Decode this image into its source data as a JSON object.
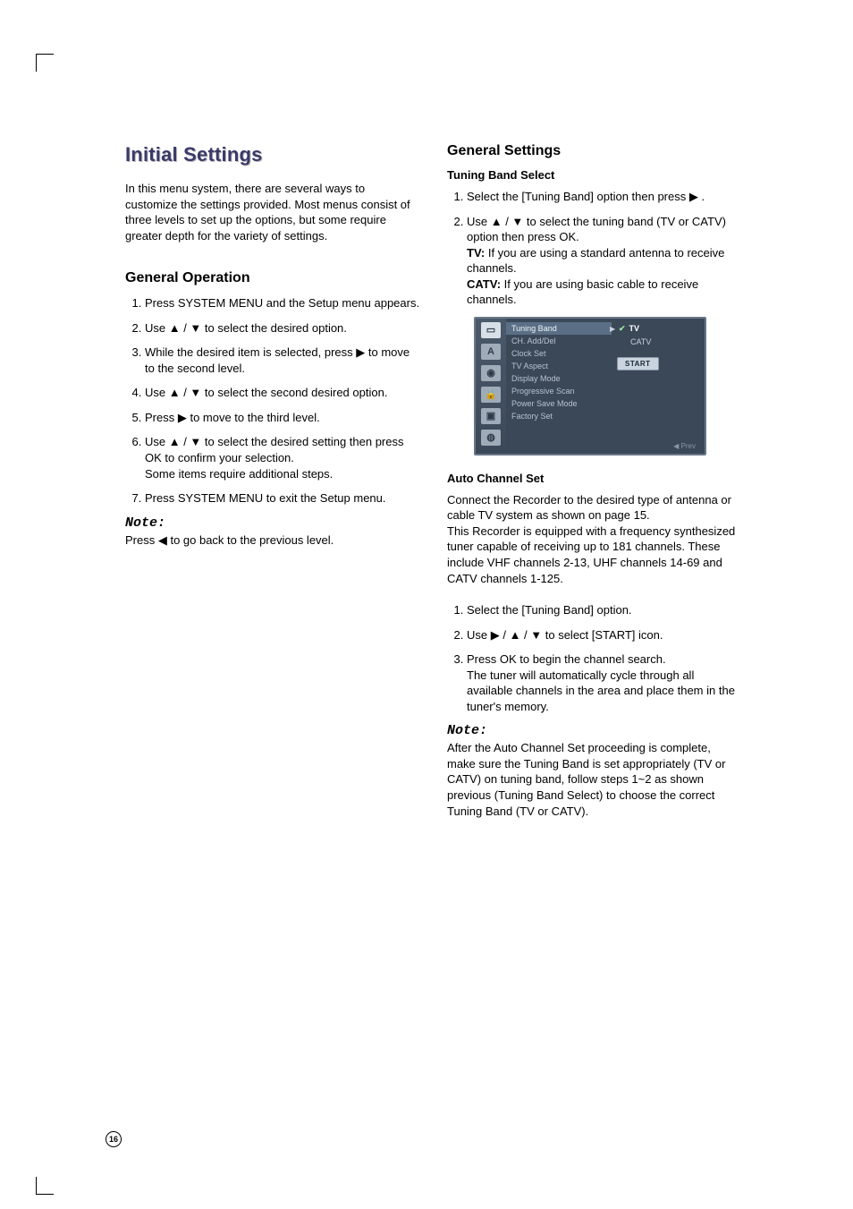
{
  "page_number": "16",
  "left": {
    "title": "Initial Settings",
    "intro": "In this menu system, there are several ways to customize the settings provided. Most menus consist of three levels to set up the options, but some require greater depth for the variety of settings.",
    "h2": "General Operation",
    "steps": [
      "Press SYSTEM MENU and the Setup menu appears.",
      "Use ▲ / ▼ to select the desired option.",
      "While the desired item is selected, press ▶ to move to the second level.",
      "Use ▲ / ▼ to select the second desired option.",
      "Press ▶ to move to the third level.",
      "Use ▲ / ▼ to select the desired setting then press OK to confirm your selection.\nSome items require additional steps.",
      "Press SYSTEM MENU to exit the Setup menu."
    ],
    "note_heading": "Note:",
    "note_body": "Press ◀ to go back to the previous level."
  },
  "right": {
    "h2": "General Settings",
    "tuning": {
      "h3": "Tuning Band Select",
      "step1": "Select the [Tuning Band] option then press ▶ .",
      "step2_pre": "Use ▲ / ▼ to select the tuning band (TV or CATV)  option then press OK.",
      "step2_tv_label": "TV:",
      "step2_tv": " If you are using a standard antenna to receive channels.",
      "step2_catv_label": "CATV:",
      "step2_catv": " If you are using basic cable to receive channels."
    },
    "osd": {
      "menu": [
        "Tuning Band",
        "CH. Add/Del",
        "Clock Set",
        "TV Aspect",
        "Display Mode",
        "Progressive Scan",
        "Power Save Mode",
        "Factory Set"
      ],
      "opts": {
        "tv": "TV",
        "catv": "CATV",
        "start": "START"
      },
      "prev": "◀ Prev"
    },
    "auto": {
      "h3": "Auto Channel Set",
      "para": "Connect the Recorder to the desired type of antenna or cable TV system as shown on page 15.\nThis Recorder is equipped with a frequency synthesized tuner capable of receiving up to 181 channels. These include VHF channels 2-13, UHF channels 14-69 and CATV channels 1-125.",
      "steps": [
        "Select the [Tuning Band] option.",
        "Use ▶ / ▲ / ▼ to select [START] icon.",
        "Press OK to begin the channel search.\nThe tuner will automatically cycle through all available channels in the area and place them in the tuner's memory."
      ],
      "note_heading": "Note:",
      "note_body": "After the Auto Channel Set proceeding is complete, make sure the Tuning Band is set appropriately (TV or CATV) on tuning band, follow steps 1~2 as shown previous (Tuning Band Select) to choose the correct Tuning Band (TV or CATV)."
    }
  }
}
